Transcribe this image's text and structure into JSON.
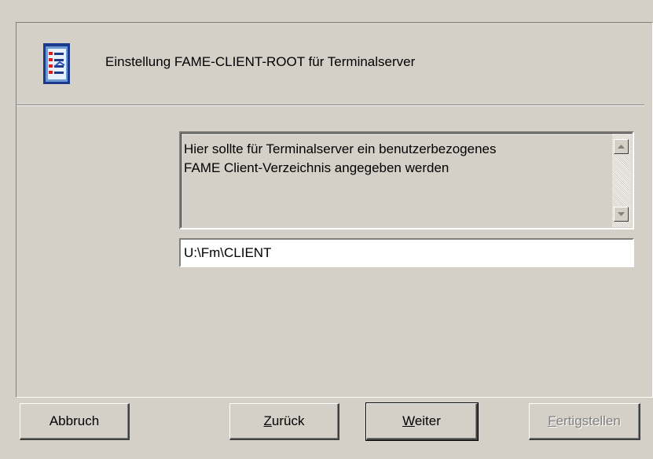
{
  "wizard": {
    "title": "Einstellung FAME-CLIENT-ROOT für Terminalserver",
    "icon": "document-list-icon"
  },
  "description": {
    "text": "Hier sollte für Terminalserver ein benutzerbezogenes\nFAME Client-Verzeichnis angegeben werden"
  },
  "path_field": {
    "value": "U:\\Fm\\CLIENT"
  },
  "buttons": {
    "abort_label": "Abbruch",
    "back_label": "Zurück",
    "next_label": "Weiter",
    "finish_label": "Fertigstellen"
  }
}
